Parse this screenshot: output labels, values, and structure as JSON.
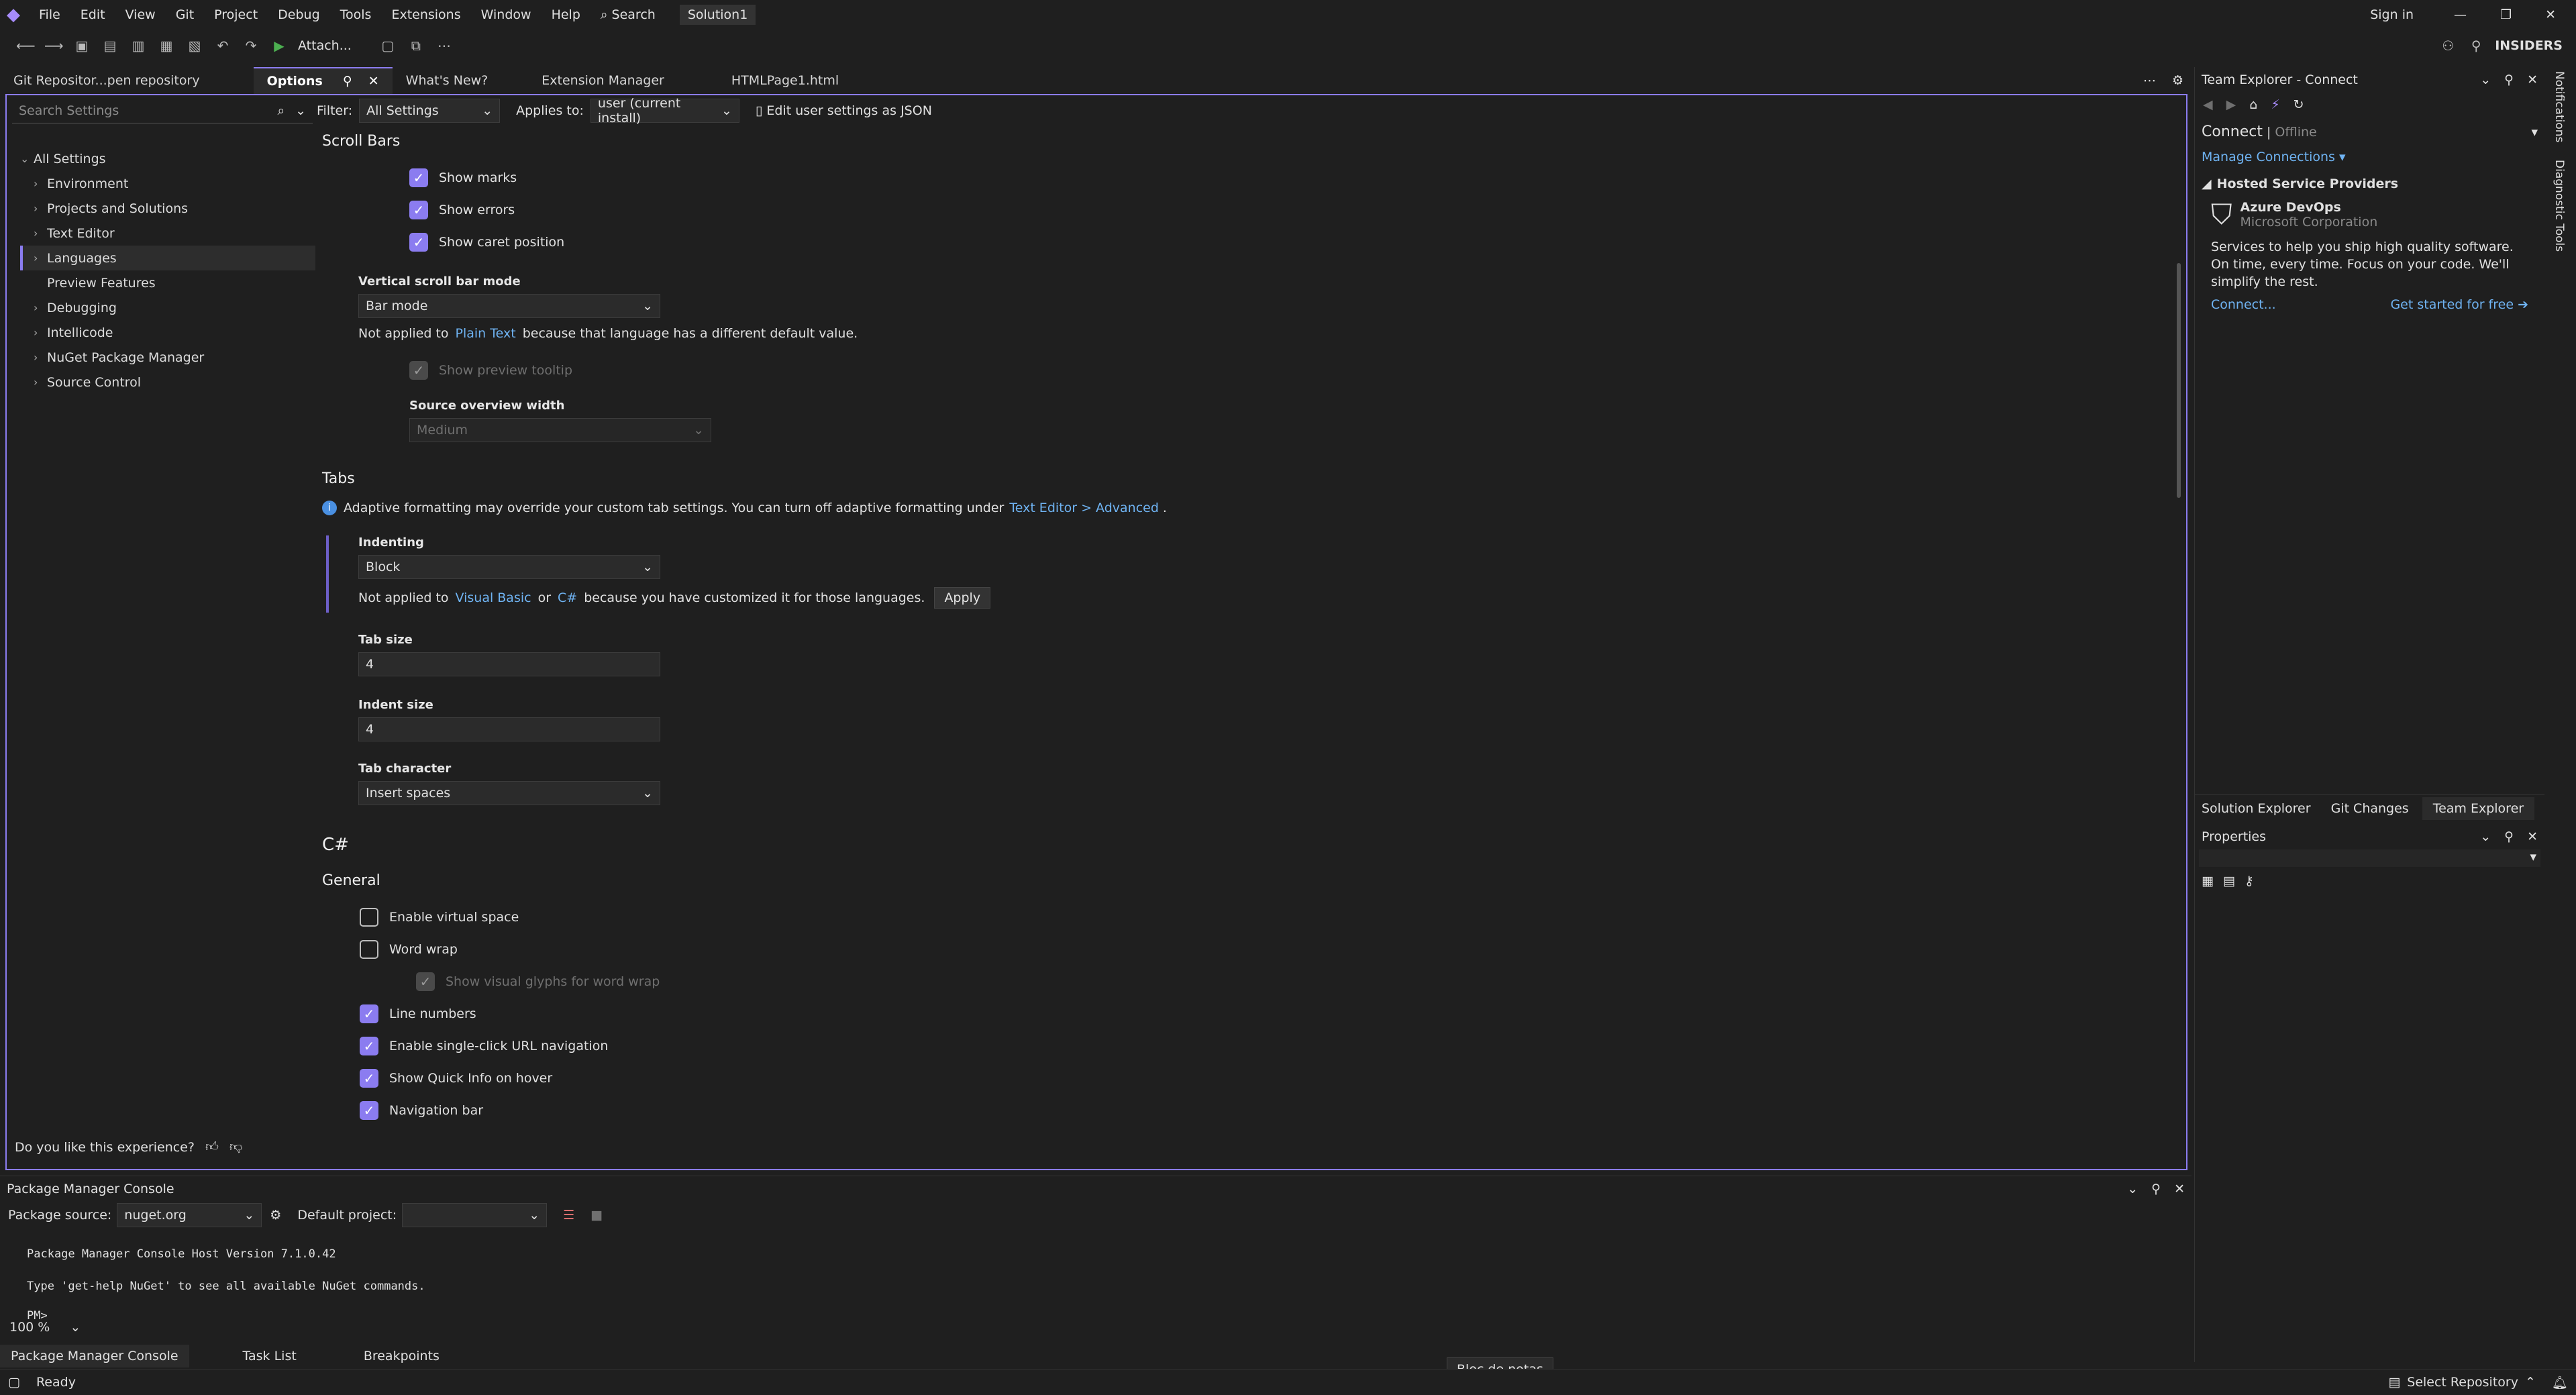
{
  "menu": {
    "items": [
      "File",
      "Edit",
      "View",
      "Git",
      "Project",
      "Debug",
      "Tools",
      "Extensions",
      "Window",
      "Help"
    ],
    "search": "Search",
    "solution": "Solution1",
    "sign_in": "Sign in",
    "insiders": "INSIDERS"
  },
  "toolbar": {
    "attach": "Attach..."
  },
  "doc_tabs": [
    "Git Repositor...pen repository",
    "Options",
    "What's New?",
    "Extension Manager",
    "HTMLPage1.html"
  ],
  "options": {
    "search_placeholder": "Search Settings",
    "filter_label": "Filter:",
    "filter_value": "All Settings",
    "applies_label": "Applies to:",
    "applies_value": "user (current install)",
    "edit_json": "Edit user settings as JSON",
    "tree": [
      {
        "label": "All Settings"
      },
      {
        "label": "Environment"
      },
      {
        "label": "Projects and Solutions"
      },
      {
        "label": "Text Editor"
      },
      {
        "label": "Languages"
      },
      {
        "label": "Preview Features"
      },
      {
        "label": "Debugging"
      },
      {
        "label": "Intellicode"
      },
      {
        "label": "NuGet Package Manager"
      },
      {
        "label": "Source Control"
      }
    ],
    "feedback": "Do you like this experience?",
    "scroll_bars": {
      "title": "Scroll Bars",
      "show_marks": "Show marks",
      "show_errors": "Show errors",
      "show_caret": "Show caret position",
      "vertical_mode_label": "Vertical scroll bar mode",
      "vertical_mode_value": "Bar mode",
      "not_applied_pre": "Not applied to",
      "plain_text": "Plain Text",
      "not_applied_post": "because that language has a different default value.",
      "show_preview": "Show preview tooltip",
      "overview_width_label": "Source overview width",
      "overview_width_value": "Medium"
    },
    "tabs": {
      "title": "Tabs",
      "info_pre": "Adaptive formatting may override your custom tab settings. You can turn off adaptive formatting under",
      "info_link": "Text Editor > Advanced",
      "info_post": ".",
      "indenting_label": "Indenting",
      "indenting_value": "Block",
      "not_applied_pre": "Not applied to",
      "vb": "Visual Basic",
      "or": "or",
      "cs": "C#",
      "not_applied_post": "because you have customized it for those languages.",
      "apply": "Apply",
      "tab_size_label": "Tab size",
      "tab_size_value": "4",
      "indent_size_label": "Indent size",
      "indent_size_value": "4",
      "tab_char_label": "Tab character",
      "tab_char_value": "Insert spaces"
    },
    "csharp": {
      "title": "C#",
      "general": "General",
      "virtual_space": "Enable virtual space",
      "word_wrap": "Word wrap",
      "visual_glyphs": "Show visual glyphs for word wrap",
      "line_numbers": "Line numbers",
      "single_click": "Enable single-click URL navigation",
      "quick_info": "Show Quick Info on hover",
      "nav_bar": "Navigation bar"
    }
  },
  "team_explorer": {
    "title": "Team Explorer - Connect",
    "connect": "Connect",
    "offline": "Offline",
    "manage": "Manage Connections",
    "hosted": "Hosted Service Providers",
    "azure": "Azure DevOps",
    "microsoft": "Microsoft Corporation",
    "desc": "Services to help you ship high quality software. On time, every time. Focus on your code. We'll simplify the rest.",
    "connect_link": "Connect...",
    "started": "Get started for free",
    "tabs": [
      "Solution Explorer",
      "Git Changes",
      "Team Explorer"
    ]
  },
  "properties": {
    "title": "Properties"
  },
  "side_strip": [
    "Notifications",
    "Diagnostic Tools"
  ],
  "pmc": {
    "title": "Package Manager Console",
    "source_label": "Package source:",
    "source_value": "nuget.org",
    "project_label": "Default project:",
    "line1": "Package Manager Console Host Version 7.1.0.42",
    "line2": "Type 'get-help NuGet' to see all available NuGet commands.",
    "prompt": "PM>",
    "zoom": "100 %",
    "tabs": [
      "Package Manager Console",
      "Task List",
      "Breakpoints"
    ]
  },
  "tooltip": "Bloc de notas",
  "status": {
    "ready": "Ready",
    "select_repo": "Select Repository"
  }
}
